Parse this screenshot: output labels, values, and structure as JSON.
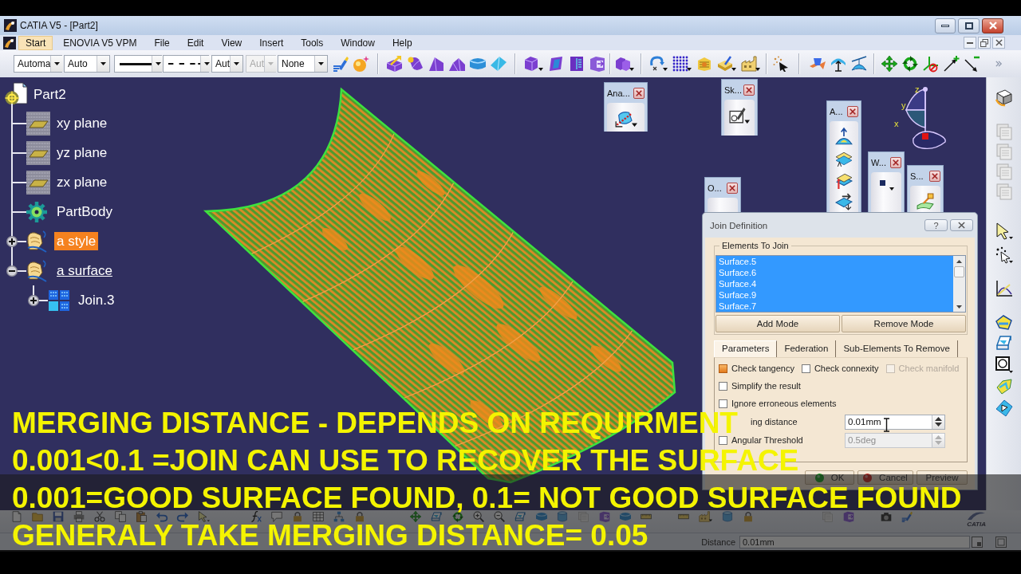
{
  "window": {
    "title": "CATIA V5 - [Part2]"
  },
  "menu_bar": {
    "items": [
      {
        "label": "Start",
        "selected": true
      },
      {
        "label": "ENOVIA V5 VPM",
        "selected": false
      },
      {
        "label": "File",
        "selected": false
      },
      {
        "label": "Edit",
        "selected": false
      },
      {
        "label": "View",
        "selected": false
      },
      {
        "label": "Insert",
        "selected": false
      },
      {
        "label": "Tools",
        "selected": false
      },
      {
        "label": "Window",
        "selected": false
      },
      {
        "label": "Help",
        "selected": false
      }
    ]
  },
  "toolbar": {
    "dropdowns": [
      {
        "kind": "text",
        "value": "Automa",
        "disabled": false
      },
      {
        "kind": "text",
        "value": "Auto",
        "disabled": false
      },
      {
        "kind": "solid",
        "disabled": false
      },
      {
        "kind": "dashed",
        "disabled": false
      },
      {
        "kind": "text",
        "value": "Aut",
        "disabled": false
      },
      {
        "kind": "text",
        "value": "Aut",
        "disabled": true
      },
      {
        "kind": "text",
        "value": "None",
        "disabled": false
      }
    ]
  },
  "tree": {
    "label": "Part2",
    "kind": "part",
    "children": [
      {
        "label": "xy plane",
        "kind": "plane",
        "selected": false,
        "in_work": false
      },
      {
        "label": "yz plane",
        "kind": "plane",
        "selected": false,
        "in_work": false
      },
      {
        "label": "zx plane",
        "kind": "plane",
        "selected": false,
        "in_work": false
      },
      {
        "label": "PartBody",
        "kind": "body",
        "selected": false,
        "in_work": false
      },
      {
        "label": "a style",
        "kind": "set",
        "expanded": false,
        "selected": true,
        "in_work": false
      },
      {
        "label": "a surface",
        "kind": "set",
        "expanded": true,
        "selected": false,
        "in_work": true,
        "children": [
          {
            "label": "Join.3",
            "kind": "join",
            "expanded": false,
            "selected": false,
            "in_work": false
          }
        ]
      }
    ]
  },
  "floating_toolbars": [
    {
      "title": "Ana..."
    },
    {
      "title": "Sk..."
    },
    {
      "title": "O..."
    },
    {
      "title": "A..."
    },
    {
      "title": "W..."
    },
    {
      "title": "S..."
    }
  ],
  "compass": {
    "labels": [
      "z",
      "y",
      "x"
    ]
  },
  "dialog": {
    "title": "Join Definition",
    "help_button": "?",
    "elements": {
      "title": "Elements To Join",
      "items": [
        {
          "label": "Surface.5",
          "selected": true
        },
        {
          "label": "Surface.6",
          "selected": true
        },
        {
          "label": "Surface.4",
          "selected": true
        },
        {
          "label": "Surface.9",
          "selected": true
        },
        {
          "label": "Surface.7",
          "selected": true
        }
      ]
    },
    "mode_buttons": [
      "Add Mode",
      "Remove Mode"
    ],
    "tabs": [
      {
        "label": "Parameters",
        "selected": true
      },
      {
        "label": "Federation",
        "selected": false
      },
      {
        "label": "Sub-Elements To Remove",
        "selected": false
      }
    ],
    "options": [
      [
        {
          "label": "Check tangency",
          "checked": true,
          "disabled": false
        },
        {
          "label": "Check connexity",
          "checked": false,
          "disabled": false
        },
        {
          "label": "Check manifold",
          "checked": false,
          "disabled": true
        }
      ],
      [
        {
          "label": "Simplify the result",
          "checked": false,
          "disabled": false
        }
      ],
      [
        {
          "label": "Ignore erroneous elements",
          "checked": false,
          "disabled": false
        }
      ]
    ],
    "merging_distance": {
      "label": "ing distance",
      "value": "0.01mm",
      "disabled": false
    },
    "angular_threshold": {
      "label": "Angular Threshold",
      "checked": false,
      "value": "0.5deg",
      "disabled": true
    },
    "buttons": [
      {
        "label": "OK",
        "kind": "ok"
      },
      {
        "label": "Cancel",
        "kind": "cancel"
      },
      {
        "label": "Preview",
        "kind": "plain"
      }
    ]
  },
  "bottom_toolbar": {
    "logo_text": "CATIA"
  },
  "status_bar": {
    "label": "Distance",
    "value": "0.01mm"
  },
  "captions": [
    "MERGING DISTANCE - DEPENDS ON REQUIRMENT",
    "0.001<0.1 =JOIN CAN USE TO RECOVER THE SURFACE",
    "0.001=GOOD SURFACE FOUND, 0.1= NOT GOOD SURFACE FOUND",
    "GENERALY TAKE MERGING DISTANCE= 0.05"
  ]
}
